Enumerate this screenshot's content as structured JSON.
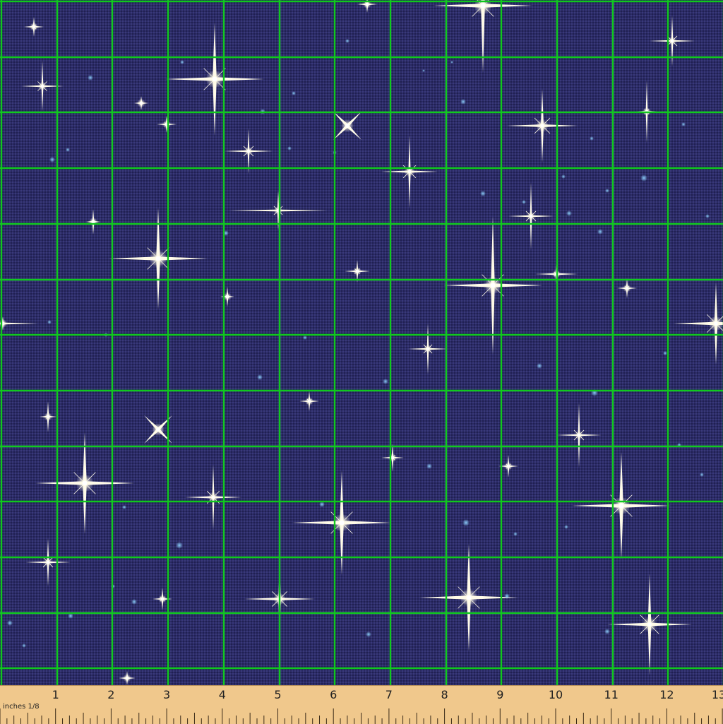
{
  "fabric": {
    "background_color": "#2b2b66",
    "grid_color": "#10c81e",
    "star_color": "#fffbe8",
    "glow_color": "#8fd3ff"
  },
  "ruler": {
    "unit_label": "inches 1/8",
    "numbers": [
      "1",
      "2",
      "3",
      "4",
      "5",
      "6",
      "7",
      "8",
      "9",
      "10",
      "11",
      "12",
      "13"
    ]
  }
}
